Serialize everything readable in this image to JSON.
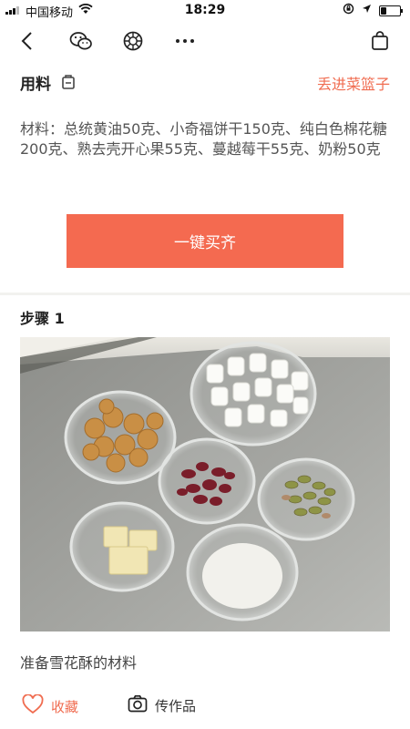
{
  "status_bar": {
    "carrier": "中国移动",
    "time": "18:29",
    "battery_level": 0.3
  },
  "nav_bar": {
    "icons": [
      "back-arrow-icon",
      "wechat-icon",
      "moments-icon",
      "more-icon",
      "shopping-bag-icon"
    ]
  },
  "ingredients_section": {
    "title": "用料",
    "basket_link": "丢进菜篮子",
    "text": "材料：总统黄油50克、小奇福饼干150克、纯白色棉花糖200克、熟去壳开心果55克、蔓越莓干55克、奶粉50克",
    "buy_all_button": "一键买齐"
  },
  "step": {
    "title": "步骤 1",
    "description": "准备雪花酥的材料"
  },
  "bottom_bar": {
    "favorite_label": "收藏",
    "upload_label": "传作品"
  },
  "colors": {
    "accent": "#f46a50"
  }
}
